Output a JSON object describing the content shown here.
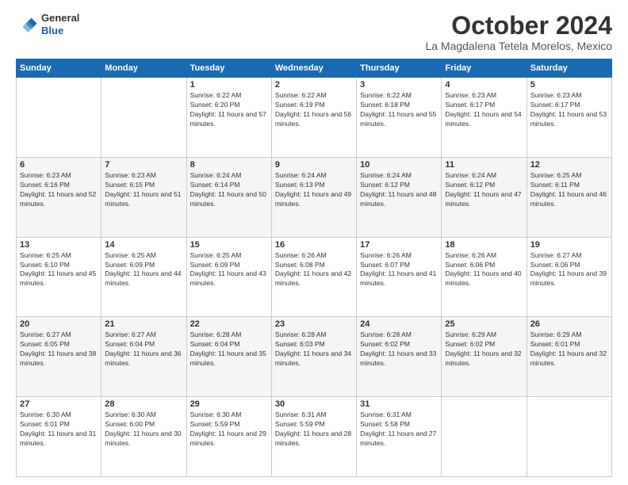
{
  "header": {
    "logo_line1": "General",
    "logo_line2": "Blue",
    "month": "October 2024",
    "location": "La Magdalena Tetela Morelos, Mexico"
  },
  "weekdays": [
    "Sunday",
    "Monday",
    "Tuesday",
    "Wednesday",
    "Thursday",
    "Friday",
    "Saturday"
  ],
  "weeks": [
    [
      {
        "day": "",
        "info": ""
      },
      {
        "day": "",
        "info": ""
      },
      {
        "day": "1",
        "info": "Sunrise: 6:22 AM\nSunset: 6:20 PM\nDaylight: 11 hours and 57 minutes."
      },
      {
        "day": "2",
        "info": "Sunrise: 6:22 AM\nSunset: 6:19 PM\nDaylight: 11 hours and 56 minutes."
      },
      {
        "day": "3",
        "info": "Sunrise: 6:22 AM\nSunset: 6:18 PM\nDaylight: 11 hours and 55 minutes."
      },
      {
        "day": "4",
        "info": "Sunrise: 6:23 AM\nSunset: 6:17 PM\nDaylight: 11 hours and 54 minutes."
      },
      {
        "day": "5",
        "info": "Sunrise: 6:23 AM\nSunset: 6:17 PM\nDaylight: 11 hours and 53 minutes."
      }
    ],
    [
      {
        "day": "6",
        "info": "Sunrise: 6:23 AM\nSunset: 6:16 PM\nDaylight: 11 hours and 52 minutes."
      },
      {
        "day": "7",
        "info": "Sunrise: 6:23 AM\nSunset: 6:15 PM\nDaylight: 11 hours and 51 minutes."
      },
      {
        "day": "8",
        "info": "Sunrise: 6:24 AM\nSunset: 6:14 PM\nDaylight: 11 hours and 50 minutes."
      },
      {
        "day": "9",
        "info": "Sunrise: 6:24 AM\nSunset: 6:13 PM\nDaylight: 11 hours and 49 minutes."
      },
      {
        "day": "10",
        "info": "Sunrise: 6:24 AM\nSunset: 6:12 PM\nDaylight: 11 hours and 48 minutes."
      },
      {
        "day": "11",
        "info": "Sunrise: 6:24 AM\nSunset: 6:12 PM\nDaylight: 11 hours and 47 minutes."
      },
      {
        "day": "12",
        "info": "Sunrise: 6:25 AM\nSunset: 6:11 PM\nDaylight: 11 hours and 46 minutes."
      }
    ],
    [
      {
        "day": "13",
        "info": "Sunrise: 6:25 AM\nSunset: 6:10 PM\nDaylight: 11 hours and 45 minutes."
      },
      {
        "day": "14",
        "info": "Sunrise: 6:25 AM\nSunset: 6:09 PM\nDaylight: 11 hours and 44 minutes."
      },
      {
        "day": "15",
        "info": "Sunrise: 6:25 AM\nSunset: 6:09 PM\nDaylight: 11 hours and 43 minutes."
      },
      {
        "day": "16",
        "info": "Sunrise: 6:26 AM\nSunset: 6:08 PM\nDaylight: 11 hours and 42 minutes."
      },
      {
        "day": "17",
        "info": "Sunrise: 6:26 AM\nSunset: 6:07 PM\nDaylight: 11 hours and 41 minutes."
      },
      {
        "day": "18",
        "info": "Sunrise: 6:26 AM\nSunset: 6:06 PM\nDaylight: 11 hours and 40 minutes."
      },
      {
        "day": "19",
        "info": "Sunrise: 6:27 AM\nSunset: 6:06 PM\nDaylight: 11 hours and 39 minutes."
      }
    ],
    [
      {
        "day": "20",
        "info": "Sunrise: 6:27 AM\nSunset: 6:05 PM\nDaylight: 11 hours and 38 minutes."
      },
      {
        "day": "21",
        "info": "Sunrise: 6:27 AM\nSunset: 6:04 PM\nDaylight: 11 hours and 36 minutes."
      },
      {
        "day": "22",
        "info": "Sunrise: 6:28 AM\nSunset: 6:04 PM\nDaylight: 11 hours and 35 minutes."
      },
      {
        "day": "23",
        "info": "Sunrise: 6:28 AM\nSunset: 6:03 PM\nDaylight: 11 hours and 34 minutes."
      },
      {
        "day": "24",
        "info": "Sunrise: 6:28 AM\nSunset: 6:02 PM\nDaylight: 11 hours and 33 minutes."
      },
      {
        "day": "25",
        "info": "Sunrise: 6:29 AM\nSunset: 6:02 PM\nDaylight: 11 hours and 32 minutes."
      },
      {
        "day": "26",
        "info": "Sunrise: 6:29 AM\nSunset: 6:01 PM\nDaylight: 11 hours and 32 minutes."
      }
    ],
    [
      {
        "day": "27",
        "info": "Sunrise: 6:30 AM\nSunset: 6:01 PM\nDaylight: 11 hours and 31 minutes."
      },
      {
        "day": "28",
        "info": "Sunrise: 6:30 AM\nSunset: 6:00 PM\nDaylight: 11 hours and 30 minutes."
      },
      {
        "day": "29",
        "info": "Sunrise: 6:30 AM\nSunset: 5:59 PM\nDaylight: 11 hours and 29 minutes."
      },
      {
        "day": "30",
        "info": "Sunrise: 6:31 AM\nSunset: 5:59 PM\nDaylight: 11 hours and 28 minutes."
      },
      {
        "day": "31",
        "info": "Sunrise: 6:31 AM\nSunset: 5:58 PM\nDaylight: 11 hours and 27 minutes."
      },
      {
        "day": "",
        "info": ""
      },
      {
        "day": "",
        "info": ""
      }
    ]
  ]
}
